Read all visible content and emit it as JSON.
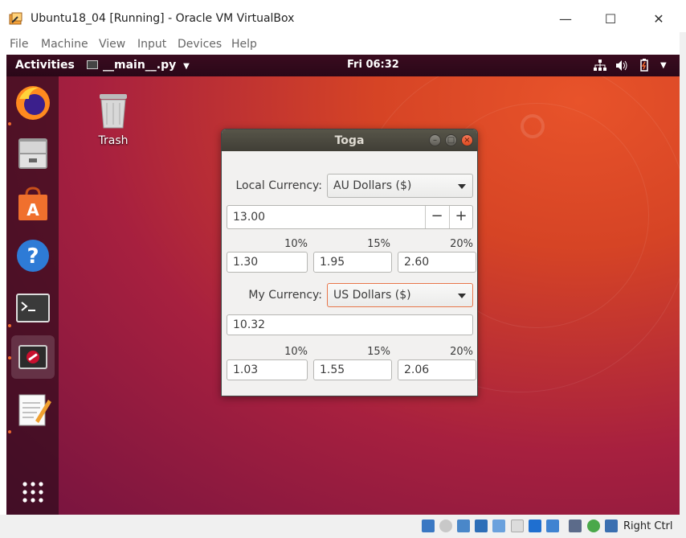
{
  "host": {
    "title": "Ubuntu18_04 [Running] - Oracle VM VirtualBox",
    "menu": [
      "File",
      "Machine",
      "View",
      "Input",
      "Devices",
      "Help"
    ],
    "status": {
      "host_key": "Right Ctrl"
    }
  },
  "guest": {
    "topbar": {
      "activities": "Activities",
      "app_menu": "__main__.py",
      "clock": "Fri 06:32"
    },
    "desktop": {
      "trash_label": "Trash"
    }
  },
  "toga": {
    "title": "Toga",
    "local_currency": {
      "label": "Local Currency:",
      "selected": "AU Dollars ($)"
    },
    "amount": {
      "value": "13.00",
      "minus": "−",
      "plus": "+"
    },
    "local_tips": {
      "headers": [
        "10%",
        "15%",
        "20%"
      ],
      "values": [
        "1.30",
        "1.95",
        "2.60"
      ]
    },
    "my_currency": {
      "label": "My Currency:",
      "selected": "US Dollars ($)"
    },
    "converted": {
      "value": "10.32"
    },
    "my_tips": {
      "headers": [
        "10%",
        "15%",
        "20%"
      ],
      "values": [
        "1.03",
        "1.55",
        "2.06"
      ]
    }
  },
  "colors": {
    "desktop_accent": "#e8532a",
    "dock_running_dot": "#f06a2f",
    "toga_titlebar": "#403e36",
    "toga_close": "#df4a20"
  }
}
